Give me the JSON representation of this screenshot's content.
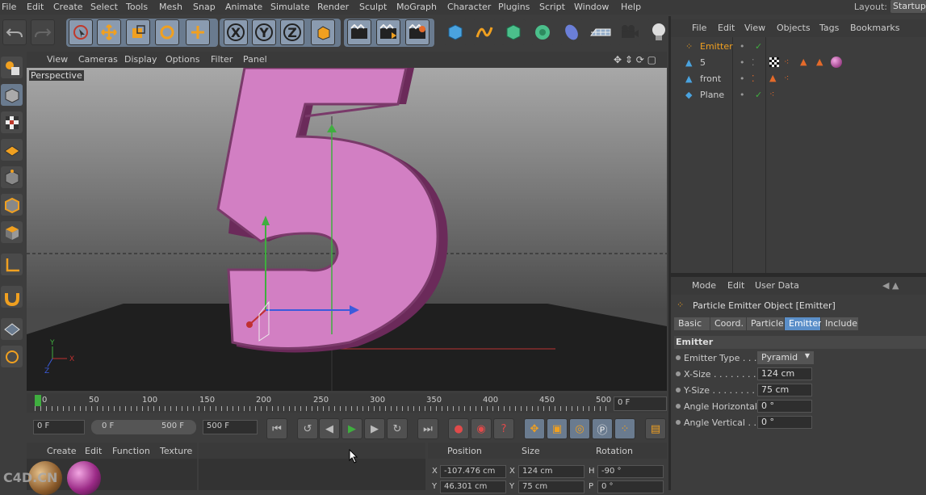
{
  "menubar": {
    "items": [
      "File",
      "Edit",
      "Create",
      "Select",
      "Tools",
      "Mesh",
      "Snap",
      "Animate",
      "Simulate",
      "Render",
      "Sculpt",
      "MoGraph",
      "Character",
      "Plugins",
      "Script",
      "Window",
      "Help"
    ],
    "layout_label": "Layout:",
    "layout_value": "Startup"
  },
  "toolbar": {
    "axis_x": "X",
    "axis_y": "Y",
    "axis_z": "Z"
  },
  "viewport": {
    "menu": [
      "View",
      "Cameras",
      "Display",
      "Options",
      "Filter",
      "Panel"
    ],
    "camera_label": "Perspective",
    "digit": "5",
    "axis_x": "X",
    "axis_y": "Y",
    "axis_z": "Z"
  },
  "timeline": {
    "ticks": [
      "0",
      "50",
      "100",
      "150",
      "200",
      "250",
      "300",
      "350",
      "400",
      "450",
      "500"
    ],
    "current_frame": "0 F"
  },
  "playback": {
    "start": "0 F",
    "range_start": "0 F",
    "range_end": "500 F",
    "end": "500 F"
  },
  "material_manager": {
    "menu": [
      "Create",
      "Edit",
      "Function",
      "Texture"
    ]
  },
  "coordinates": {
    "headers": {
      "position": "Position",
      "size": "Size",
      "rotation": "Rotation"
    },
    "row_x": {
      "axis": "X",
      "pos": "-107.476 cm",
      "size_axis": "X",
      "size": "124 cm",
      "rot_axis": "H",
      "rot": "-90 °"
    },
    "row_y": {
      "axis": "Y",
      "pos": "46.301 cm",
      "size_axis": "Y",
      "size": "75 cm",
      "rot_axis": "P",
      "rot": "0 °"
    }
  },
  "object_manager": {
    "menu": [
      "File",
      "Edit",
      "View",
      "Objects",
      "Tags",
      "Bookmarks"
    ],
    "objects": [
      {
        "name": "Emitter",
        "selected": true
      },
      {
        "name": "5",
        "selected": false
      },
      {
        "name": "front",
        "selected": false
      },
      {
        "name": "Plane",
        "selected": false
      }
    ]
  },
  "attribute_manager": {
    "menu": [
      "Mode",
      "Edit",
      "User Data"
    ],
    "title": "Particle Emitter Object [Emitter]",
    "tabs": [
      "Basic",
      "Coord.",
      "Particle",
      "Emitter",
      "Include"
    ],
    "active_tab": "Emitter",
    "section": "Emitter",
    "params": [
      {
        "label": "Emitter Type . . . .",
        "value": "Pyramid"
      },
      {
        "label": "X-Size . . . . . . . . . .",
        "value": "124 cm"
      },
      {
        "label": "Y-Size . . . . . . . . . .",
        "value": "75 cm"
      },
      {
        "label": "Angle Horizontal",
        "value": "0 °"
      },
      {
        "label": "Angle Vertical . .",
        "value": "0 °"
      }
    ]
  },
  "watermark": "C4D.CN",
  "colors": {
    "accent": "#5b8fc9",
    "emitter_selected": "#f0a020",
    "digit_face": "#d27fc3",
    "digit_side": "#6b2a5a"
  }
}
